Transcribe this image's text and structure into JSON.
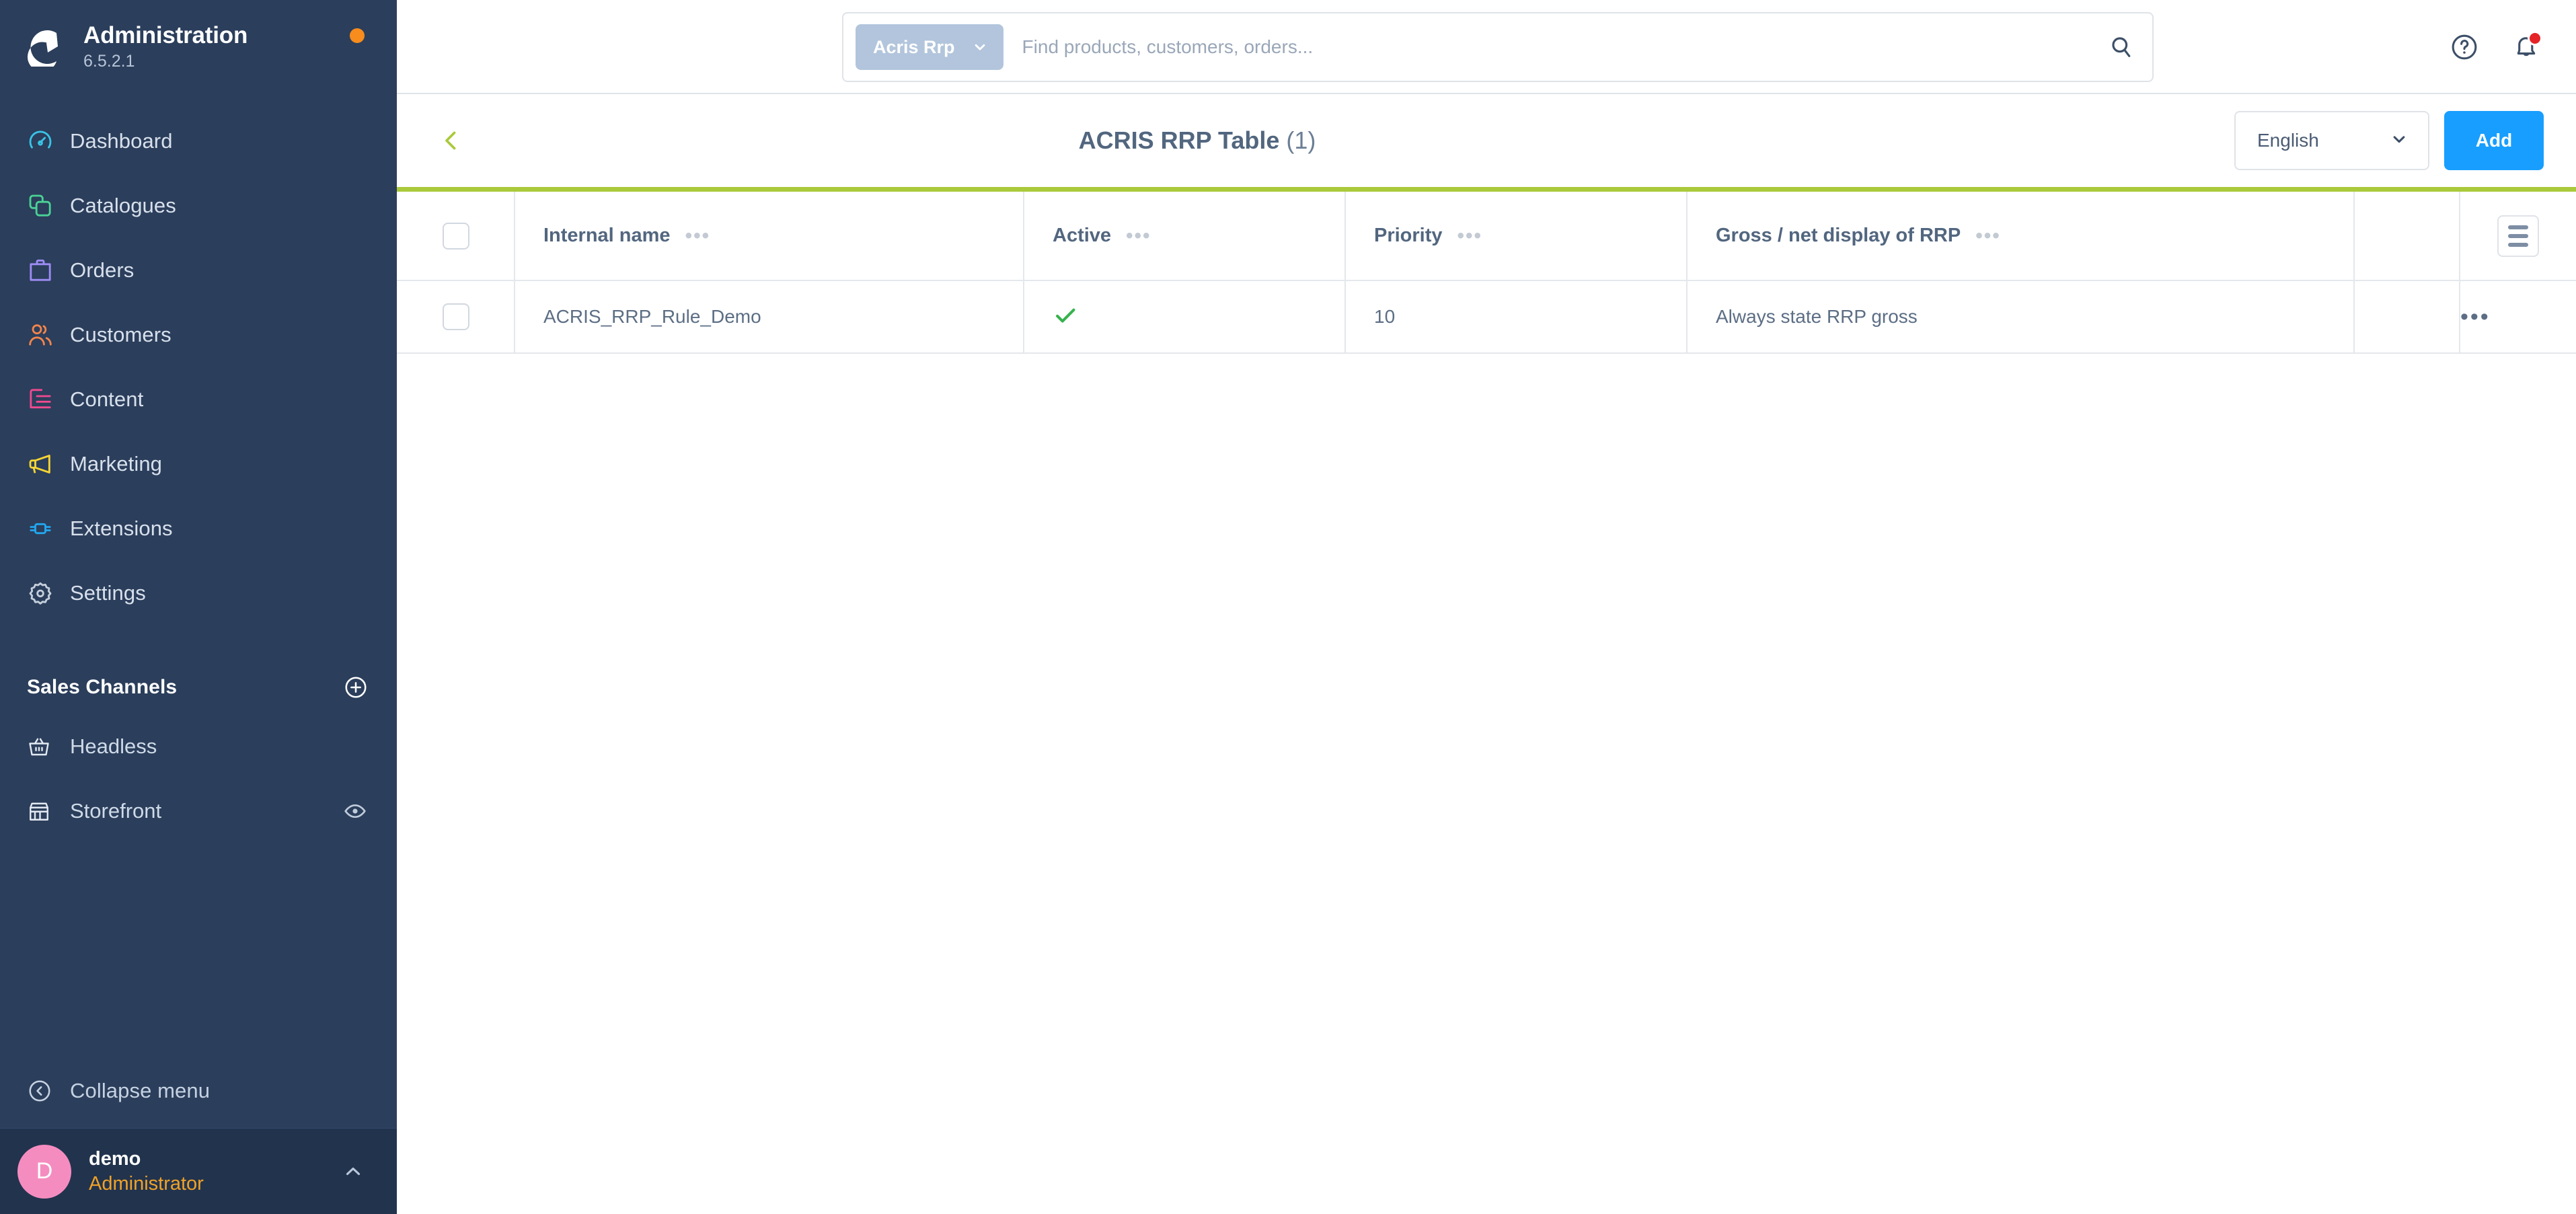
{
  "sidebar": {
    "brand": {
      "title": "Administration",
      "version": "6.5.2.1",
      "logo_icon": "shopware-logo-icon",
      "status_dot_color": "#f88c1c"
    },
    "nav_items": [
      {
        "label": "Dashboard",
        "icon": "dashboard-icon",
        "color": "#39c4e8"
      },
      {
        "label": "Catalogues",
        "icon": "catalogues-icon",
        "color": "#4ad295"
      },
      {
        "label": "Orders",
        "icon": "orders-icon",
        "color": "#9d8cf5"
      },
      {
        "label": "Customers",
        "icon": "customers-icon",
        "color": "#f2854c"
      },
      {
        "label": "Content",
        "icon": "content-icon",
        "color": "#ef4a90"
      },
      {
        "label": "Marketing",
        "icon": "marketing-icon",
        "color": "#f7d534"
      },
      {
        "label": "Extensions",
        "icon": "extensions-icon",
        "color": "#22a6ef"
      },
      {
        "label": "Settings",
        "icon": "gear-icon",
        "color": "#c5cfdc"
      }
    ],
    "sales_channels": {
      "title": "Sales Channels",
      "add_icon": "plus-circle-icon",
      "items": [
        {
          "label": "Headless",
          "icon": "basket-icon",
          "has_eye": false
        },
        {
          "label": "Storefront",
          "icon": "storefront-icon",
          "has_eye": true,
          "eye_icon": "eye-icon"
        }
      ]
    },
    "collapse": {
      "label": "Collapse menu",
      "icon": "collapse-left-icon"
    },
    "user": {
      "initial": "D",
      "name": "demo",
      "role": "Administrator",
      "chevron_icon": "chevron-up-icon",
      "avatar_color": "#f58cc0",
      "role_color": "#f0a227"
    }
  },
  "topbar": {
    "search": {
      "scope_label": "Acris Rrp",
      "scope_chevron_icon": "chevron-down-icon",
      "value": "",
      "placeholder": "Find products, customers, orders...",
      "search_icon": "search-icon"
    },
    "help_icon": "help-circle-icon",
    "notification_icon": "bell-icon",
    "notification_badge": true
  },
  "page_header": {
    "back_icon": "chevron-left-icon",
    "title": "ACRIS RRP Table",
    "count": "(1)",
    "language": {
      "label": "English",
      "chevron_icon": "chevron-down-icon"
    },
    "add_label": "Add",
    "accent_color": "#aac93b",
    "add_color": "#189eff"
  },
  "table": {
    "select_all_checkbox": false,
    "column_options_icon": "ellipsis-icon",
    "settings_icon": "table-settings-icon",
    "row_context_icon": "ellipsis-icon",
    "columns": [
      {
        "key": "internal_name",
        "label": "Internal name"
      },
      {
        "key": "active",
        "label": "Active"
      },
      {
        "key": "priority",
        "label": "Priority"
      },
      {
        "key": "gross_net",
        "label": "Gross / net display of RRP"
      }
    ],
    "rows": [
      {
        "selected": false,
        "internal_name": "ACRIS_RRP_Rule_Demo",
        "active": true,
        "active_icon": "check-icon",
        "priority": "10",
        "gross_net": "Always state RRP gross"
      }
    ]
  }
}
